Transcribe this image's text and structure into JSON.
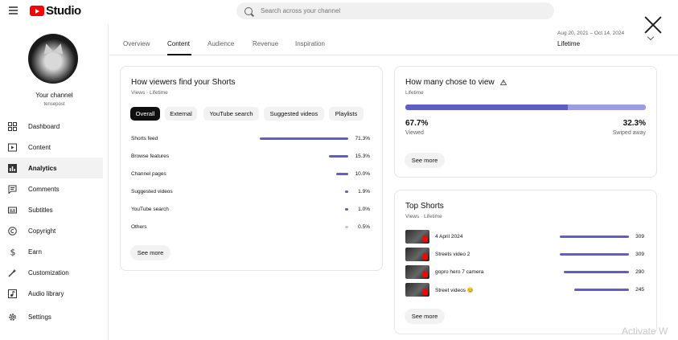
{
  "app": {
    "brand": "Studio"
  },
  "search": {
    "placeholder": "Search across your channel"
  },
  "channel": {
    "name": "Your channel",
    "handle": "tensepost"
  },
  "sidebar": {
    "items": [
      {
        "label": "Dashboard",
        "icon": "dashboard-icon"
      },
      {
        "label": "Content",
        "icon": "content-icon"
      },
      {
        "label": "Analytics",
        "icon": "analytics-icon",
        "active": true
      },
      {
        "label": "Comments",
        "icon": "comments-icon"
      },
      {
        "label": "Subtitles",
        "icon": "subtitles-icon"
      },
      {
        "label": "Copyright",
        "icon": "copyright-icon"
      },
      {
        "label": "Earn",
        "icon": "earn-icon"
      },
      {
        "label": "Customization",
        "icon": "customization-icon"
      },
      {
        "label": "Audio library",
        "icon": "audio-library-icon"
      },
      {
        "label": "Settings",
        "icon": "settings-icon"
      }
    ]
  },
  "tabs": [
    {
      "label": "Overview"
    },
    {
      "label": "Content",
      "active": true
    },
    {
      "label": "Audience"
    },
    {
      "label": "Revenue"
    },
    {
      "label": "Inspiration"
    }
  ],
  "date": {
    "range": "Aug 20, 2021 – Oct 14, 2024",
    "period": "Lifetime"
  },
  "find_card": {
    "title": "How viewers find your Shorts",
    "subtitle": "Views · Lifetime",
    "chips": [
      {
        "label": "Overall",
        "active": true
      },
      {
        "label": "External"
      },
      {
        "label": "YouTube search"
      },
      {
        "label": "Suggested videos"
      },
      {
        "label": "Playlists"
      }
    ],
    "rows": [
      {
        "label": "Shorts feed",
        "value": 71.3,
        "pct": "71.3%"
      },
      {
        "label": "Browse features",
        "value": 15.3,
        "pct": "15.3%"
      },
      {
        "label": "Channel pages",
        "value": 10.0,
        "pct": "10.0%"
      },
      {
        "label": "Suggested videos",
        "value": 1.9,
        "pct": "1.9%"
      },
      {
        "label": "YouTube search",
        "value": 1.0,
        "pct": "1.0%"
      },
      {
        "label": "Others",
        "value": 0.5,
        "pct": "0.5%"
      }
    ],
    "see_more": "See more"
  },
  "view_card": {
    "title": "How many chose to view",
    "subtitle": "Lifetime",
    "viewed_value": 67.7,
    "viewed_pct": "67.7%",
    "viewed_label": "Viewed",
    "swiped_pct": "32.3%",
    "swiped_label": "Swiped away",
    "see_more": "See more"
  },
  "top_card": {
    "title": "Top Shorts",
    "subtitle": "Views · Lifetime",
    "items": [
      {
        "title": "4 April 2024",
        "views": 309,
        "views_label": "309"
      },
      {
        "title": "Streets video 2",
        "views": 309,
        "views_label": "309"
      },
      {
        "title": "gopro hero 7 camera",
        "views": 290,
        "views_label": "290"
      },
      {
        "title": "Street videos 😊",
        "views": 245,
        "views_label": "245"
      }
    ],
    "see_more": "See more"
  },
  "watermark": "Activate W",
  "colors": {
    "accent": "#5e5ec9",
    "accent_light": "#9c9ce0",
    "brand_red": "#ff0000"
  }
}
